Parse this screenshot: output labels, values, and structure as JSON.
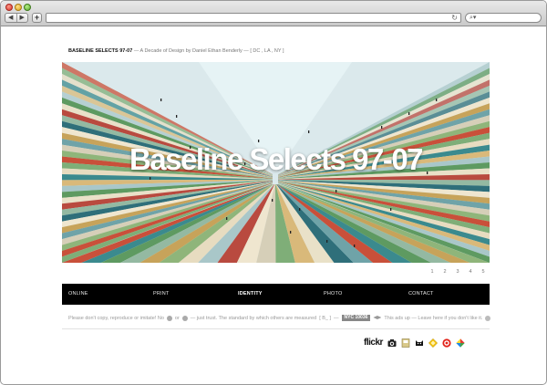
{
  "header": {
    "site_name": "BASELINE SELECTS 97-07",
    "tagline": "— A Decade of Design by Daniel Ethan Benderly —",
    "locations": "[ DC , LA , NY ]"
  },
  "hero": {
    "title": "Baseline Selects 97-07"
  },
  "pagination": [
    "1",
    "2",
    "3",
    "4",
    "5"
  ],
  "nav": {
    "items": [
      "ONLINE",
      "PRINT",
      "IDENTITY",
      "PHOTO",
      "CONTACT"
    ],
    "active": "IDENTITY"
  },
  "footer": {
    "part1": "Please don't copy, reproduce or imitate! No",
    "part2": "or",
    "part3": "— just trust. The standard by which others are measured",
    "bracket": "[ B_ ]",
    "dash": "—",
    "nyc": "NYC 10036",
    "part4": "This ads up — Leave here if you don't like it."
  },
  "social": {
    "flickr_label": "flickr",
    "icons": [
      "camera-icon",
      "notebook-icon",
      "cat-icon",
      "diamond-icon",
      "target-icon",
      "color-square-icon"
    ]
  },
  "colors": {
    "navbar": "#000000",
    "hero_sky": "#e6f0f2"
  }
}
